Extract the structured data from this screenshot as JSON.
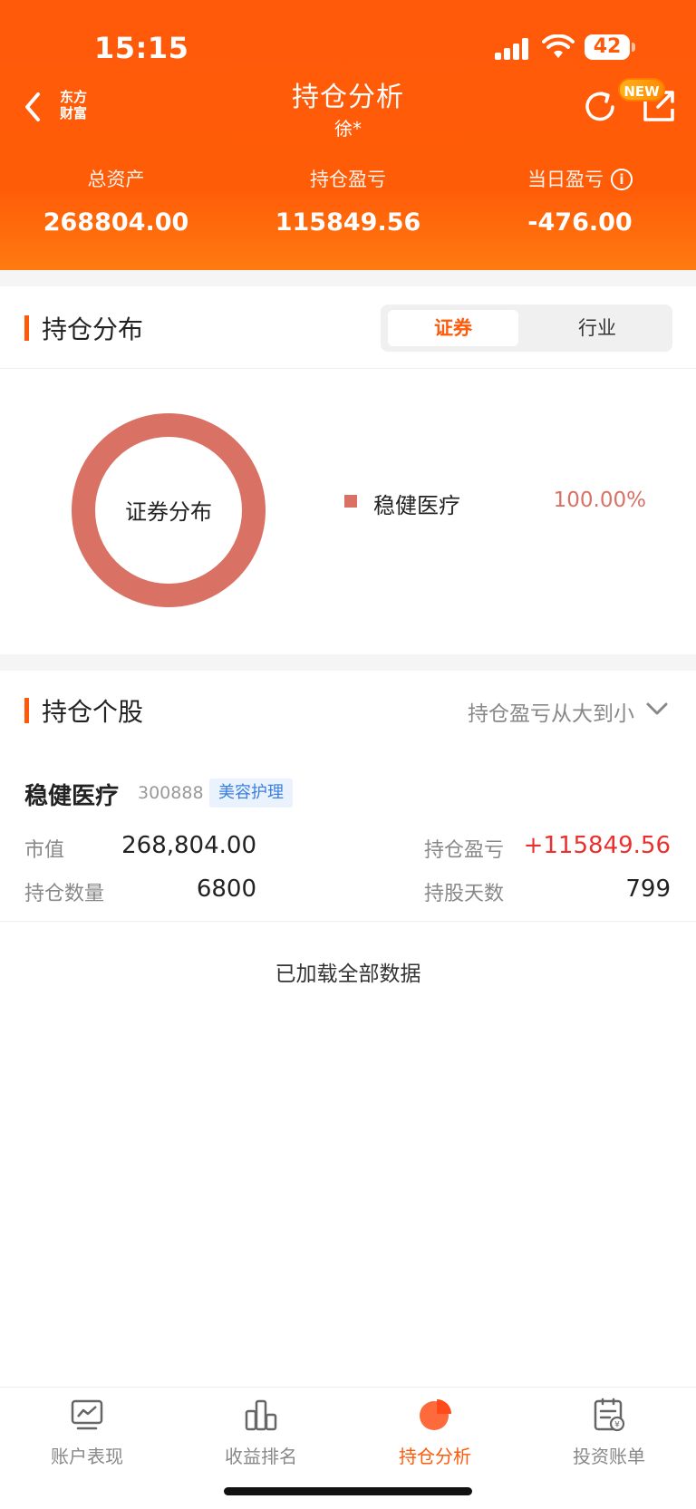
{
  "status_bar": {
    "time": "15:15",
    "battery": "42"
  },
  "header": {
    "logo_line1": "东方",
    "logo_line2": "财富",
    "title": "持仓分析",
    "subtitle": "徐*",
    "new_badge": "NEW",
    "stats": [
      {
        "label": "总资产",
        "value": "268804.00"
      },
      {
        "label": "持仓盈亏",
        "value": "115849.56"
      },
      {
        "label": "当日盈亏",
        "value": "-476.00"
      }
    ]
  },
  "distribution": {
    "title": "持仓分布",
    "toggle": {
      "active": "证券",
      "inactive": "行业"
    },
    "donut_label": "证券分布",
    "legend": [
      {
        "name": "稳健医疗",
        "percent": "100.00%",
        "color": "#d97264"
      }
    ]
  },
  "chart_data": {
    "type": "pie",
    "title": "证券分布",
    "series": [
      {
        "categories": [
          "稳健医疗"
        ],
        "values": [
          100.0
        ]
      }
    ]
  },
  "holdings": {
    "title": "持仓个股",
    "sort_label": "持仓盈亏从大到小",
    "items": [
      {
        "name": "稳健医疗",
        "code": "300888",
        "tag": "美容护理",
        "market_value_label": "市值",
        "market_value": "268,804.00",
        "pnl_label": "持仓盈亏",
        "pnl": "+115849.56",
        "qty_label": "持仓数量",
        "qty": "6800",
        "days_label": "持股天数",
        "days": "799"
      }
    ],
    "footer": "已加载全部数据"
  },
  "tabbar": {
    "tabs": [
      {
        "label": "账户表现",
        "icon": "chart-screen-icon"
      },
      {
        "label": "收益排名",
        "icon": "bar-ranking-icon"
      },
      {
        "label": "持仓分析",
        "icon": "pie-chart-icon",
        "active": true
      },
      {
        "label": "投资账单",
        "icon": "bill-icon"
      }
    ]
  },
  "colors": {
    "brand": "#ff5a0a",
    "up": "#e8312f",
    "donut": "#d97264",
    "tag_blue": "#3b7fe0"
  }
}
